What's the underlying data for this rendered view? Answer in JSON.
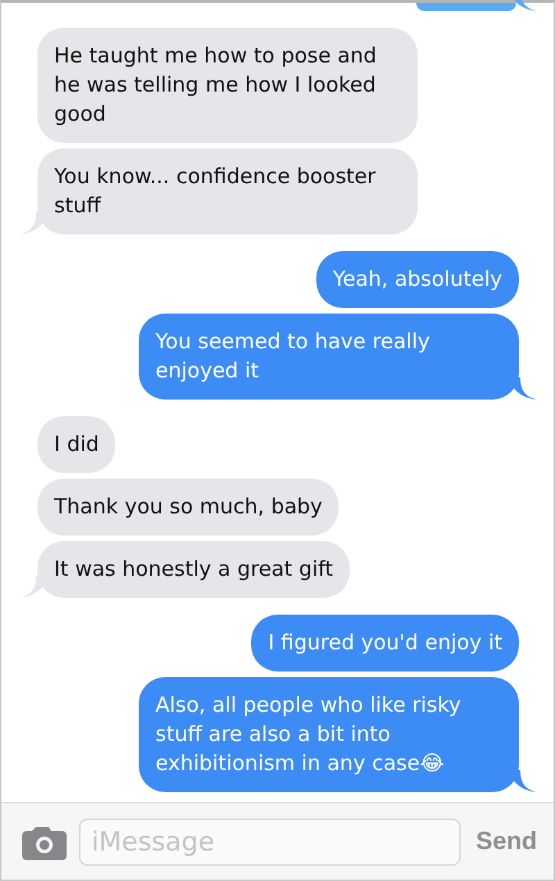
{
  "conversation": [
    {
      "outgoing": true,
      "kind": "clipped"
    },
    {
      "outgoing": false,
      "kind": "group",
      "messages": [
        "He taught me how to pose and he was telling me how I looked good",
        "You know... confidence booster stuff"
      ]
    },
    {
      "outgoing": true,
      "kind": "group",
      "messages": [
        "Yeah, absolutely",
        "You seemed to have really enjoyed it"
      ]
    },
    {
      "outgoing": false,
      "kind": "group",
      "messages": [
        "I did",
        "Thank you so much, baby",
        "It was honestly a great gift"
      ]
    },
    {
      "outgoing": true,
      "kind": "group",
      "messages": [
        "I figured you'd enjoy it",
        "Also, all people who like risky stuff are also a bit into exhibitionism in any case😂"
      ]
    }
  ],
  "composer": {
    "placeholder": "iMessage",
    "send_label": "Send"
  }
}
